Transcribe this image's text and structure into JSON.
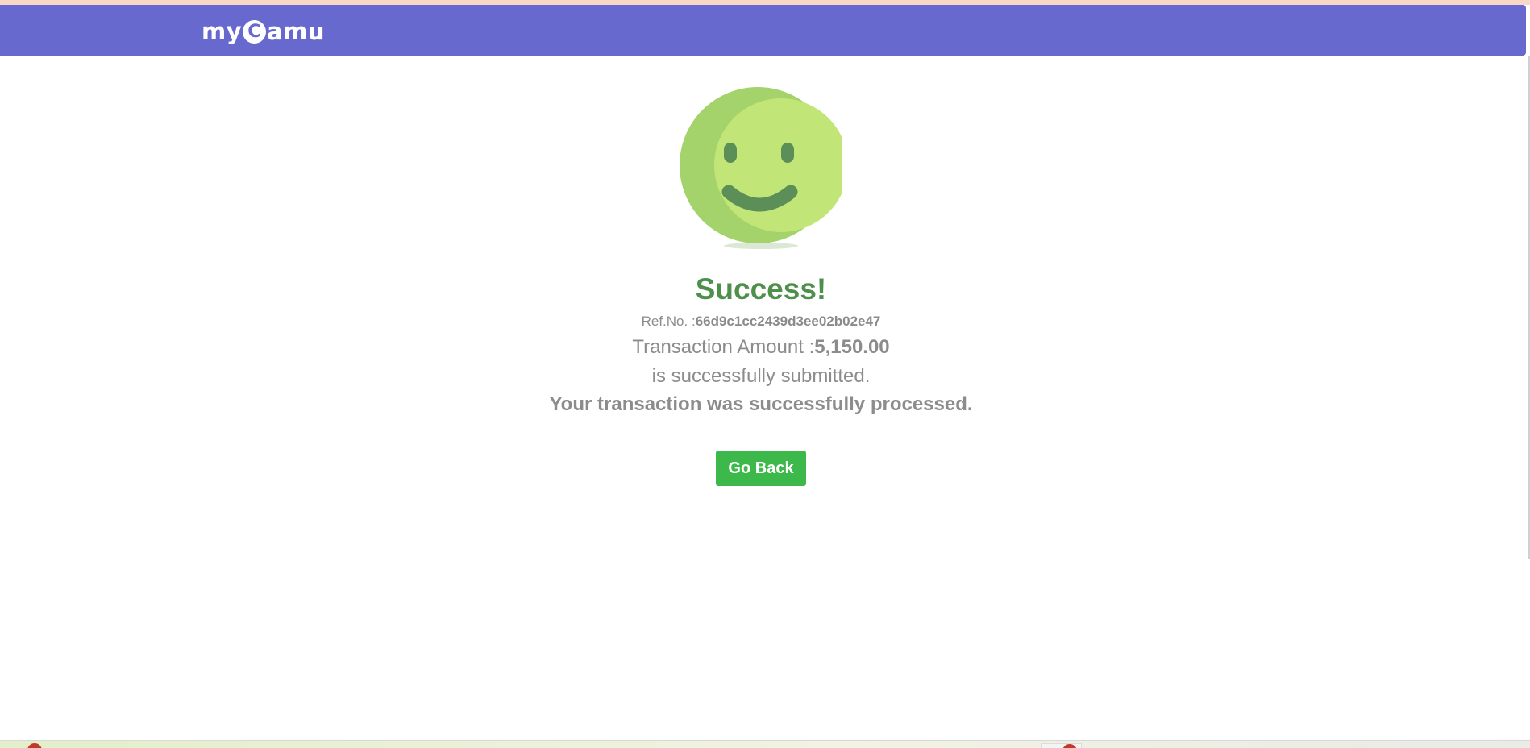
{
  "header": {
    "logo_prefix": "my",
    "logo_mark": "C",
    "logo_suffix": "amu",
    "color": "#6869cf"
  },
  "status": {
    "icon": "smiley-face-icon",
    "title": "Success!",
    "ref_label": "Ref.No. :",
    "ref_value": "66d9c1cc2439d3ee02b02e47",
    "amount_label": "Transaction Amount :",
    "amount_value": "5,150.00",
    "submitted_text": "is successfully submitted.",
    "processed_text": "Your transaction was successfully processed.",
    "title_color": "#4f8f4c"
  },
  "actions": {
    "go_back_label": "Go Back",
    "button_color": "#3cb94a"
  }
}
